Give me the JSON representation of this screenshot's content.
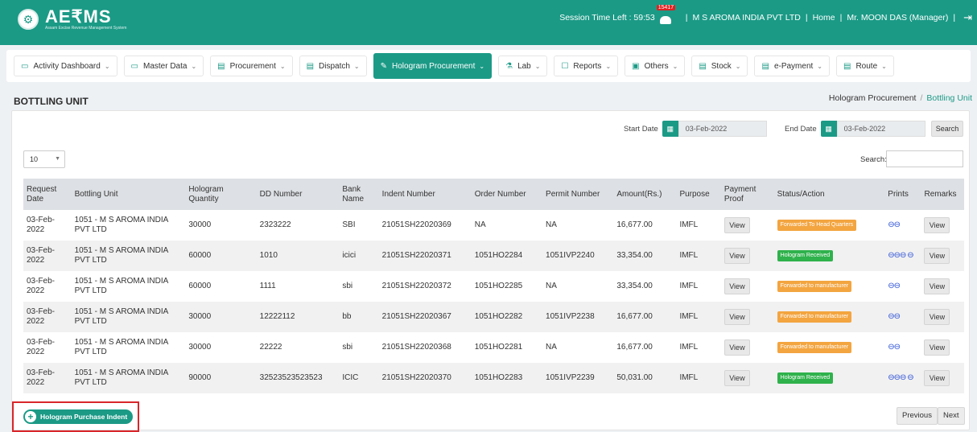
{
  "app": {
    "name": "AE₹MS",
    "tagline": "Assam Excise Revenue Management System"
  },
  "header": {
    "session_label": "Session Time Left : 59:53",
    "notification_count": "15417",
    "company": "M S AROMA INDIA PVT LTD",
    "home": "Home",
    "user": "Mr. MOON DAS (Manager)"
  },
  "menu": [
    {
      "label": "Activity Dashboard",
      "icon": "dashboard-icon"
    },
    {
      "label": "Master Data",
      "icon": "dashboard-icon"
    },
    {
      "label": "Procurement",
      "icon": "doc-icon"
    },
    {
      "label": "Dispatch",
      "icon": "doc-icon"
    },
    {
      "label": "Hologram Procurement",
      "icon": "pen-icon",
      "active": true
    },
    {
      "label": "Lab",
      "icon": "flask-icon"
    },
    {
      "label": "Reports",
      "icon": "report-icon"
    },
    {
      "label": "Others",
      "icon": "box-icon"
    },
    {
      "label": "Stock",
      "icon": "doc-icon"
    },
    {
      "label": "e-Payment",
      "icon": "doc-icon"
    },
    {
      "label": "Route",
      "icon": "doc-icon"
    }
  ],
  "page": {
    "title": "BOTTLING UNIT",
    "crumb_parent": "Hologram Procurement",
    "crumb_current": "Bottling Unit"
  },
  "filters": {
    "start_label": "Start Date",
    "start_value": "03-Feb-2022",
    "end_label": "End Date",
    "end_value": "03-Feb-2022",
    "search_button": "Search",
    "page_length": "10",
    "search_label": "Search:"
  },
  "table": {
    "headers": [
      "Request Date",
      "Bottling Unit",
      "Hologram Quantity",
      "DD Number",
      "Bank Name",
      "Indent Number",
      "Order Number",
      "Permit Number",
      "Amount(Rs.)",
      "Purpose",
      "Payment Proof",
      "Status/Action",
      "Prints",
      "Remarks"
    ],
    "rows": [
      {
        "date": "03-Feb-2022",
        "unit": "1051 - M S AROMA INDIA PVT LTD",
        "qty": "30000",
        "dd": "2323222",
        "bank": "SBI",
        "indent": "21051SH22020369",
        "order": "NA",
        "permit": "NA",
        "amount": "16,677.00",
        "purpose": "IMFL",
        "proof": "View",
        "status": "Forwarded To Head Quarters",
        "status_color": "#f3a540",
        "prints": "⊖⊖",
        "remarks": "View"
      },
      {
        "date": "03-Feb-2022",
        "unit": "1051 - M S AROMA INDIA PVT LTD",
        "qty": "60000",
        "dd": "1010",
        "bank": "icici",
        "indent": "21051SH22020371",
        "order": "1051HO2284",
        "permit": "1051IVP2240",
        "amount": "33,354.00",
        "purpose": "IMFL",
        "proof": "View",
        "status": "Hologram Received",
        "status_color": "#2fb24c",
        "prints": "⊖⊖⊖ ⊖",
        "remarks": "View"
      },
      {
        "date": "03-Feb-2022",
        "unit": "1051 - M S AROMA INDIA PVT LTD",
        "qty": "60000",
        "dd": "1111",
        "bank": "sbi",
        "indent": "21051SH22020372",
        "order": "1051HO2285",
        "permit": "NA",
        "amount": "33,354.00",
        "purpose": "IMFL",
        "proof": "View",
        "status": "Forwarded to manufacturer",
        "status_color": "#f3a540",
        "prints": "⊖⊖",
        "remarks": "View"
      },
      {
        "date": "03-Feb-2022",
        "unit": "1051 - M S AROMA INDIA PVT LTD",
        "qty": "30000",
        "dd": "12222112",
        "bank": "bb",
        "indent": "21051SH22020367",
        "order": "1051HO2282",
        "permit": "1051IVP2238",
        "amount": "16,677.00",
        "purpose": "IMFL",
        "proof": "View",
        "status": "Forwarded to manufacturer",
        "status_color": "#f3a540",
        "prints": "⊖⊖",
        "remarks": "View"
      },
      {
        "date": "03-Feb-2022",
        "unit": "1051 - M S AROMA INDIA PVT LTD",
        "qty": "30000",
        "dd": "22222",
        "bank": "sbi",
        "indent": "21051SH22020368",
        "order": "1051HO2281",
        "permit": "NA",
        "amount": "16,677.00",
        "purpose": "IMFL",
        "proof": "View",
        "status": "Forwarded to manufacturer",
        "status_color": "#f3a540",
        "prints": "⊖⊖",
        "remarks": "View"
      },
      {
        "date": "03-Feb-2022",
        "unit": "1051 - M S AROMA INDIA PVT LTD",
        "qty": "90000",
        "dd": "32523523523523",
        "bank": "ICIC",
        "indent": "21051SH22020370",
        "order": "1051HO2283",
        "permit": "1051IVP2239",
        "amount": "50,031.00",
        "purpose": "IMFL",
        "proof": "View",
        "status": "Hologram Received",
        "status_color": "#2fb24c",
        "prints": "⊖⊖⊖ ⊖",
        "remarks": "View"
      }
    ]
  },
  "footer": {
    "indent_button": "Hologram Purchase Indent",
    "previous": "Previous",
    "next": "Next"
  },
  "colors": {
    "brand": "#1b9a86",
    "highlight": "#d9262a"
  }
}
